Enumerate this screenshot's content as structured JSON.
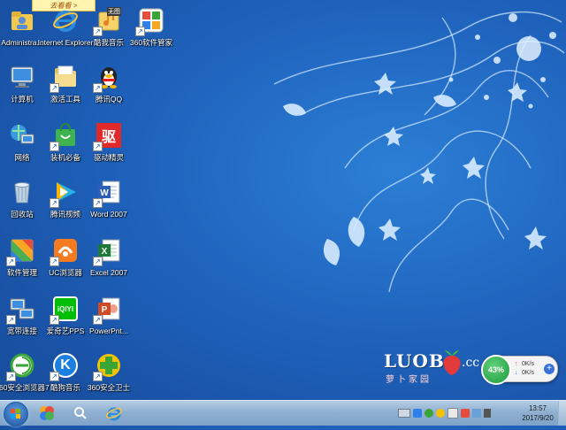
{
  "top_banner": {
    "text": "去看看 >"
  },
  "desktop_icons": [
    {
      "label": "Administra..."
    },
    {
      "label": "Internet Explorer"
    },
    {
      "label": "酷我音乐",
      "badge": "无图"
    },
    {
      "label": "360软件管家"
    },
    {
      "label": "计算机"
    },
    {
      "label": "激活工具"
    },
    {
      "label": "腾讯QQ"
    },
    {
      "label": "网络"
    },
    {
      "label": "装机必备"
    },
    {
      "label": "驱动精灵",
      "glyph": "驱"
    },
    {
      "label": "回收站"
    },
    {
      "label": "腾讯视频"
    },
    {
      "label": "Word 2007"
    },
    {
      "label": "软件管理"
    },
    {
      "label": "UC浏览器"
    },
    {
      "label": "Excel 2007"
    },
    {
      "label": "宽带连接"
    },
    {
      "label": "爱奇艺PPS",
      "glyph": "iQIYI"
    },
    {
      "label": "PowerPnt..."
    },
    {
      "label": "360安全浏览器7"
    },
    {
      "label": "酷狗音乐",
      "glyph": "K"
    },
    {
      "label": "360安全卫士"
    }
  ],
  "watermark": {
    "brand": "LUOB",
    "suffix": ".cc",
    "chinese": "萝卜家园"
  },
  "speed_widget": {
    "percent": "43%",
    "up_rate": "0K/s",
    "down_rate": "0K/s"
  },
  "taskbar": {
    "clock_time": "13:57",
    "clock_date": "2017/9/20"
  },
  "colors": {
    "desktop_bg": "#1f63bd",
    "taskbar": "#8fb0d2",
    "widget_green": "#1e9a3c"
  }
}
